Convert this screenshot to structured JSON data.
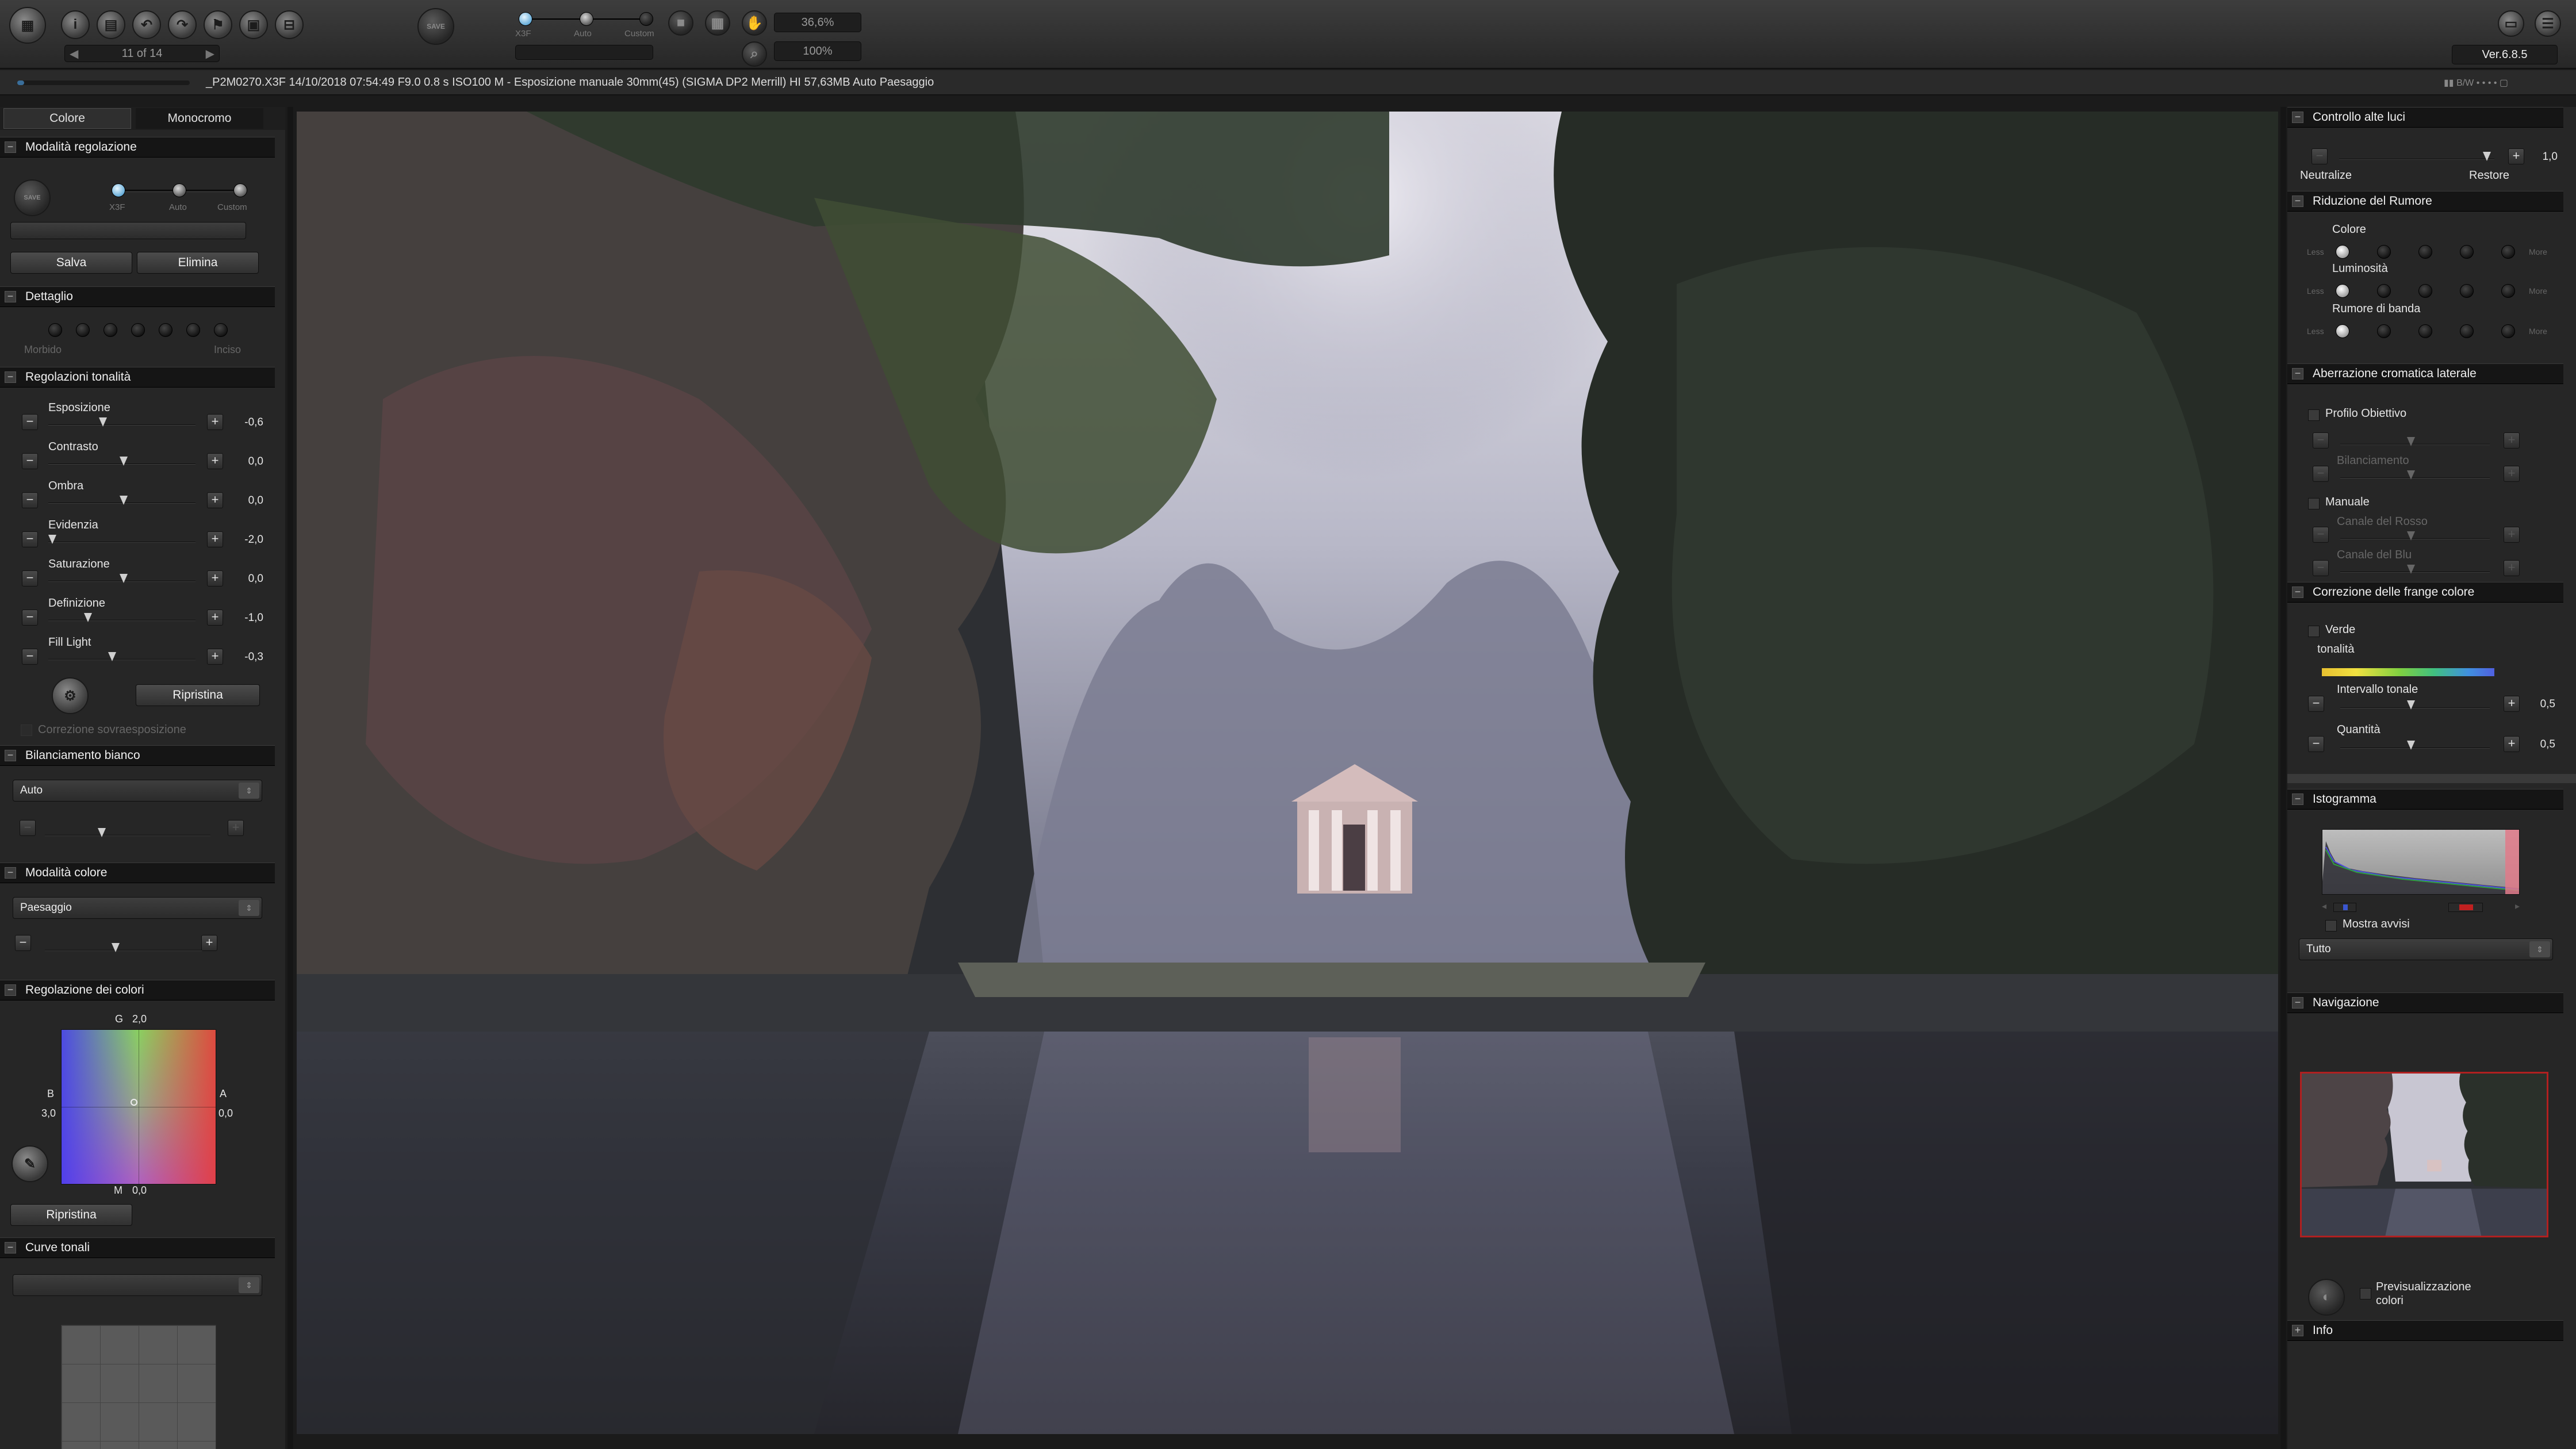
{
  "toolbar": {
    "nav_counter": "11 of 14",
    "mode_labels": [
      "X3F",
      "Auto",
      "Custom"
    ],
    "zoom_fit": "36,6%",
    "zoom_100": "100%",
    "save_icon_label": "SAVE",
    "version": "Ver.6.8.5",
    "icons": [
      "app-logo-icon",
      "info-icon",
      "print-icon",
      "rotate-left-icon",
      "rotate-right-icon",
      "flag-icon",
      "delete-icon",
      "lock-icon"
    ]
  },
  "infobar": {
    "file_info": "_P2M0270.X3F 14/10/2018 07:54:49 F9.0 0.8 s ISO100 M - Esposizione manuale 30mm(45) (SIGMA DP2 Merrill) HI 57,63MB Auto Paesaggio",
    "bw_label": "B/W"
  },
  "left": {
    "tabs": [
      "Colore",
      "Monocromo"
    ],
    "modalita": {
      "title": "Modalità regolazione",
      "save_icon_label": "SAVE",
      "mode_labels": [
        "X3F",
        "Auto",
        "Custom"
      ],
      "save_button": "Salva",
      "delete_button": "Elimina"
    },
    "dettaglio": {
      "title": "Dettaglio",
      "min_label": "Morbido",
      "max_label": "Inciso"
    },
    "tonalita": {
      "title": "Regolazioni tonalità",
      "rows": [
        {
          "label": "Esposizione",
          "value": "-0,6"
        },
        {
          "label": "Contrasto",
          "value": "0,0"
        },
        {
          "label": "Ombra",
          "value": "0,0"
        },
        {
          "label": "Evidenzia",
          "value": "-2,0"
        },
        {
          "label": "Saturazione",
          "value": "0,0"
        },
        {
          "label": "Definizione",
          "value": "-1,0"
        },
        {
          "label": "Fill Light",
          "value": "-0,3"
        }
      ],
      "reset_button": "Ripristina",
      "overexposure_label": "Correzione sovraesposizione"
    },
    "bilanciamento": {
      "title": "Bilanciamento bianco",
      "selected": "Auto"
    },
    "modalita_colore": {
      "title": "Modalità colore",
      "selected": "Paesaggio"
    },
    "regolazione_colori": {
      "title": "Regolazione dei colori",
      "g_label": "G",
      "g_value": "2,0",
      "b_label": "B",
      "b_value": "3,0",
      "a_label": "A",
      "a_value": "0,0",
      "m_label": "M",
      "m_value": "0,0",
      "reset_button": "Ripristina"
    },
    "curve": {
      "title": "Curve tonali"
    }
  },
  "right": {
    "alte_luci": {
      "title": "Controllo alte luci",
      "value": "1,0",
      "min_label": "Neutralize",
      "max_label": "Restore"
    },
    "rumore": {
      "title": "Riduzione del Rumore",
      "rows": [
        "Colore",
        "Luminosità",
        "Rumore di banda"
      ],
      "min_label": "Less",
      "max_label": "More"
    },
    "aberrazione": {
      "title": "Aberrazione cromatica laterale",
      "profilo_label": "Profilo Obiettivo",
      "bilanciamento_label": "Bilanciamento",
      "manuale_label": "Manuale",
      "rosso_label": "Canale del Rosso",
      "blu_label": "Canale del Blu"
    },
    "frange": {
      "title": "Correzione delle frange colore",
      "verde_label": "Verde",
      "tonalita_label": "tonalità",
      "intervallo_label": "Intervallo tonale",
      "intervallo_value": "0,5",
      "quantita_label": "Quantità",
      "quantita_value": "0,5"
    },
    "istogramma": {
      "title": "Istogramma",
      "warnings_label": "Mostra avvisi",
      "channel": "Tutto"
    },
    "navigazione": {
      "title": "Navigazione",
      "preview_label": "Previsualizzazione colori"
    },
    "info": {
      "title": "Info"
    }
  }
}
